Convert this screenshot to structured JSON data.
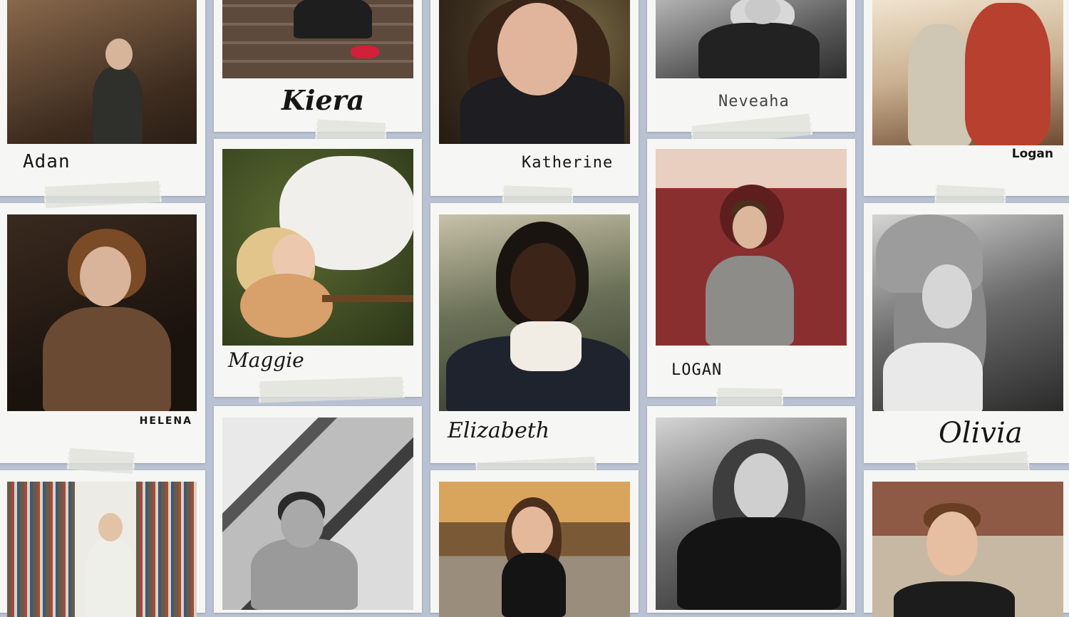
{
  "collage": {
    "cards": [
      {
        "name": "Adan",
        "style": "print"
      },
      {
        "name": "Kiera",
        "style": "script-bold"
      },
      {
        "name": "Katherine",
        "style": "print"
      },
      {
        "name": "Neveaha",
        "style": "print"
      },
      {
        "name": "Logan",
        "style": "bold"
      },
      {
        "name": "HELENA",
        "style": "caps"
      },
      {
        "name": "Maggie",
        "style": "script"
      },
      {
        "name": "Elizabeth",
        "style": "script"
      },
      {
        "name": "LOGAN",
        "style": "print"
      },
      {
        "name": "Olivia",
        "style": "script"
      },
      {
        "name": "",
        "style": "none"
      },
      {
        "name": "",
        "style": "none"
      },
      {
        "name": "",
        "style": "none"
      },
      {
        "name": "",
        "style": "none"
      },
      {
        "name": "",
        "style": "none"
      }
    ]
  },
  "colors": {
    "background": "#b9c2d3",
    "card": "#f6f6f4",
    "tape": "#e1e1da",
    "ink": "#161616"
  }
}
